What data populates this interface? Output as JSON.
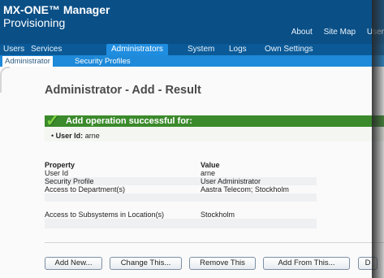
{
  "app": {
    "title_line1": "MX-ONE™ Manager",
    "title_line2": "Provisioning"
  },
  "top_links": [
    "About",
    "Site Map",
    "User"
  ],
  "nav": [
    "Users",
    "Services",
    "Administrators",
    "System",
    "Logs",
    "Own Settings"
  ],
  "nav_active": "Administrators",
  "subnav": [
    "Administrator",
    "Security Profiles"
  ],
  "subnav_active": "Administrator",
  "page_title": "Administrator - Add - Result",
  "success": {
    "message": "Add operation successful for:",
    "detail_label": "User Id:",
    "detail_value": "arne"
  },
  "table": {
    "headers": [
      "Property",
      "Value"
    ],
    "rows": [
      [
        "User Id",
        "arne"
      ],
      [
        "Security Profile",
        "User Administrator"
      ],
      [
        "Access to Department(s)",
        "Aastra Telecom; Stockholm"
      ],
      [
        "",
        ""
      ],
      [
        "Access to Subsystems in Location(s)",
        "Stockholm"
      ],
      [
        "",
        ""
      ]
    ]
  },
  "buttons": [
    "Add New...",
    "Change This...",
    "Remove This",
    "Add From This...",
    "D"
  ],
  "colors": {
    "header": "#0a4f86",
    "subnav": "#1e8ad9",
    "success_bar": "#3b8a2c"
  }
}
